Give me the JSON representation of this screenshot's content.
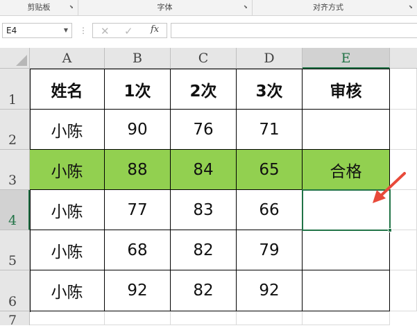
{
  "ribbon": {
    "groups": [
      {
        "label": "剪贴板"
      },
      {
        "label": "字体"
      },
      {
        "label": "对齐方式"
      }
    ]
  },
  "formula_bar": {
    "name_box": "E4",
    "cancel_icon": "✕",
    "enter_icon": "✓",
    "fx_label": "fx",
    "formula": ""
  },
  "sheet": {
    "columns": [
      "A",
      "B",
      "C",
      "D",
      "E"
    ],
    "rows": [
      "1",
      "2",
      "3",
      "4",
      "5",
      "6",
      "7"
    ],
    "active_cell": "E4",
    "cells": [
      [
        "姓名",
        "1次",
        "2次",
        "3次",
        "审核"
      ],
      [
        "小陈",
        "90",
        "76",
        "71",
        ""
      ],
      [
        "小陈",
        "88",
        "84",
        "65",
        "合格"
      ],
      [
        "小陈",
        "77",
        "83",
        "66",
        ""
      ],
      [
        "小陈",
        "68",
        "82",
        "79",
        ""
      ],
      [
        "小陈",
        "92",
        "82",
        "92",
        ""
      ]
    ],
    "highlight_row": 3,
    "highlight_color": "#92d050",
    "accent_color": "#217346",
    "annotation_arrow_color": "#e84a3a"
  }
}
